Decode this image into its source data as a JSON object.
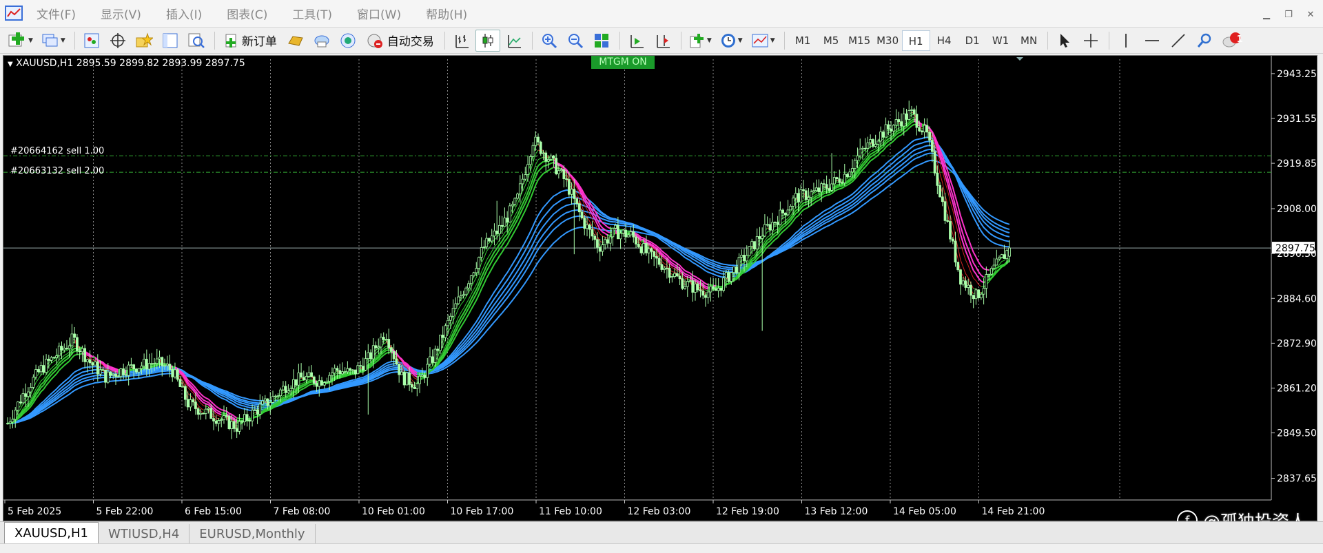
{
  "menu": {
    "items": [
      "文件(F)",
      "显示(V)",
      "插入(I)",
      "图表(C)",
      "工具(T)",
      "窗口(W)",
      "帮助(H)"
    ]
  },
  "toolbar": {
    "new_order_label": "新订单",
    "auto_trade_label": "自动交易",
    "timeframes": [
      "M1",
      "M5",
      "M15",
      "M30",
      "H1",
      "H4",
      "D1",
      "W1",
      "MN"
    ],
    "active_timeframe": "H1",
    "notification_count": "1"
  },
  "chart": {
    "symbol_info": "XAUUSD,H1  2895.59 2899.82 2893.99 2897.75",
    "badge": "MTGM ON",
    "orders": [
      "#20664162 sell 1.00",
      "#20663132 sell 2.00"
    ],
    "current_price_label": "2897.75",
    "colors": {
      "background": "#000000",
      "candle": "#aaffaa",
      "fast_ma": "#33cc33",
      "slow_ma": "#3399ff",
      "bear_ma": "#ff33cc",
      "order_line": "#33aa33"
    }
  },
  "chart_data": {
    "type": "candlestick",
    "symbol": "XAUUSD",
    "timeframe": "H1",
    "ohlc_last": {
      "open": 2895.59,
      "high": 2899.82,
      "low": 2893.99,
      "close": 2897.75
    },
    "y_ticks": [
      "2943.25",
      "2931.55",
      "2919.85",
      "2908.00",
      "2896.30",
      "2884.60",
      "2872.90",
      "2861.20",
      "2849.50",
      "2837.65"
    ],
    "ylim": [
      2832,
      2947
    ],
    "x_ticks": [
      "5 Feb 2025",
      "5 Feb 22:00",
      "6 Feb 15:00",
      "7 Feb 08:00",
      "10 Feb 01:00",
      "10 Feb 17:00",
      "11 Feb 10:00",
      "12 Feb 03:00",
      "12 Feb 19:00",
      "13 Feb 12:00",
      "14 Feb 05:00",
      "14 Feb 21:00"
    ],
    "close_series": [
      2852,
      2860,
      2866,
      2870,
      2874,
      2868,
      2864,
      2866,
      2867,
      2868,
      2866,
      2857,
      2855,
      2853,
      2851,
      2855,
      2858,
      2862,
      2864,
      2863,
      2866,
      2865,
      2869,
      2876,
      2864,
      2862,
      2870,
      2880,
      2889,
      2898,
      2903,
      2910,
      2926,
      2921,
      2915,
      2905,
      2898,
      2902,
      2901,
      2896,
      2893,
      2889,
      2887,
      2886,
      2891,
      2896,
      2902,
      2906,
      2911,
      2912,
      2914,
      2917,
      2923,
      2927,
      2930,
      2933,
      2927,
      2908,
      2890,
      2885,
      2892,
      2897.75
    ],
    "order_prices": [
      2921.8,
      2917.5
    ]
  },
  "tabs": [
    "XAUUSD,H1",
    "WTIUSD,H4",
    "EURUSD,Monthly"
  ],
  "active_tab": "XAUUSD,H1",
  "watermark": "@孤独投资人"
}
